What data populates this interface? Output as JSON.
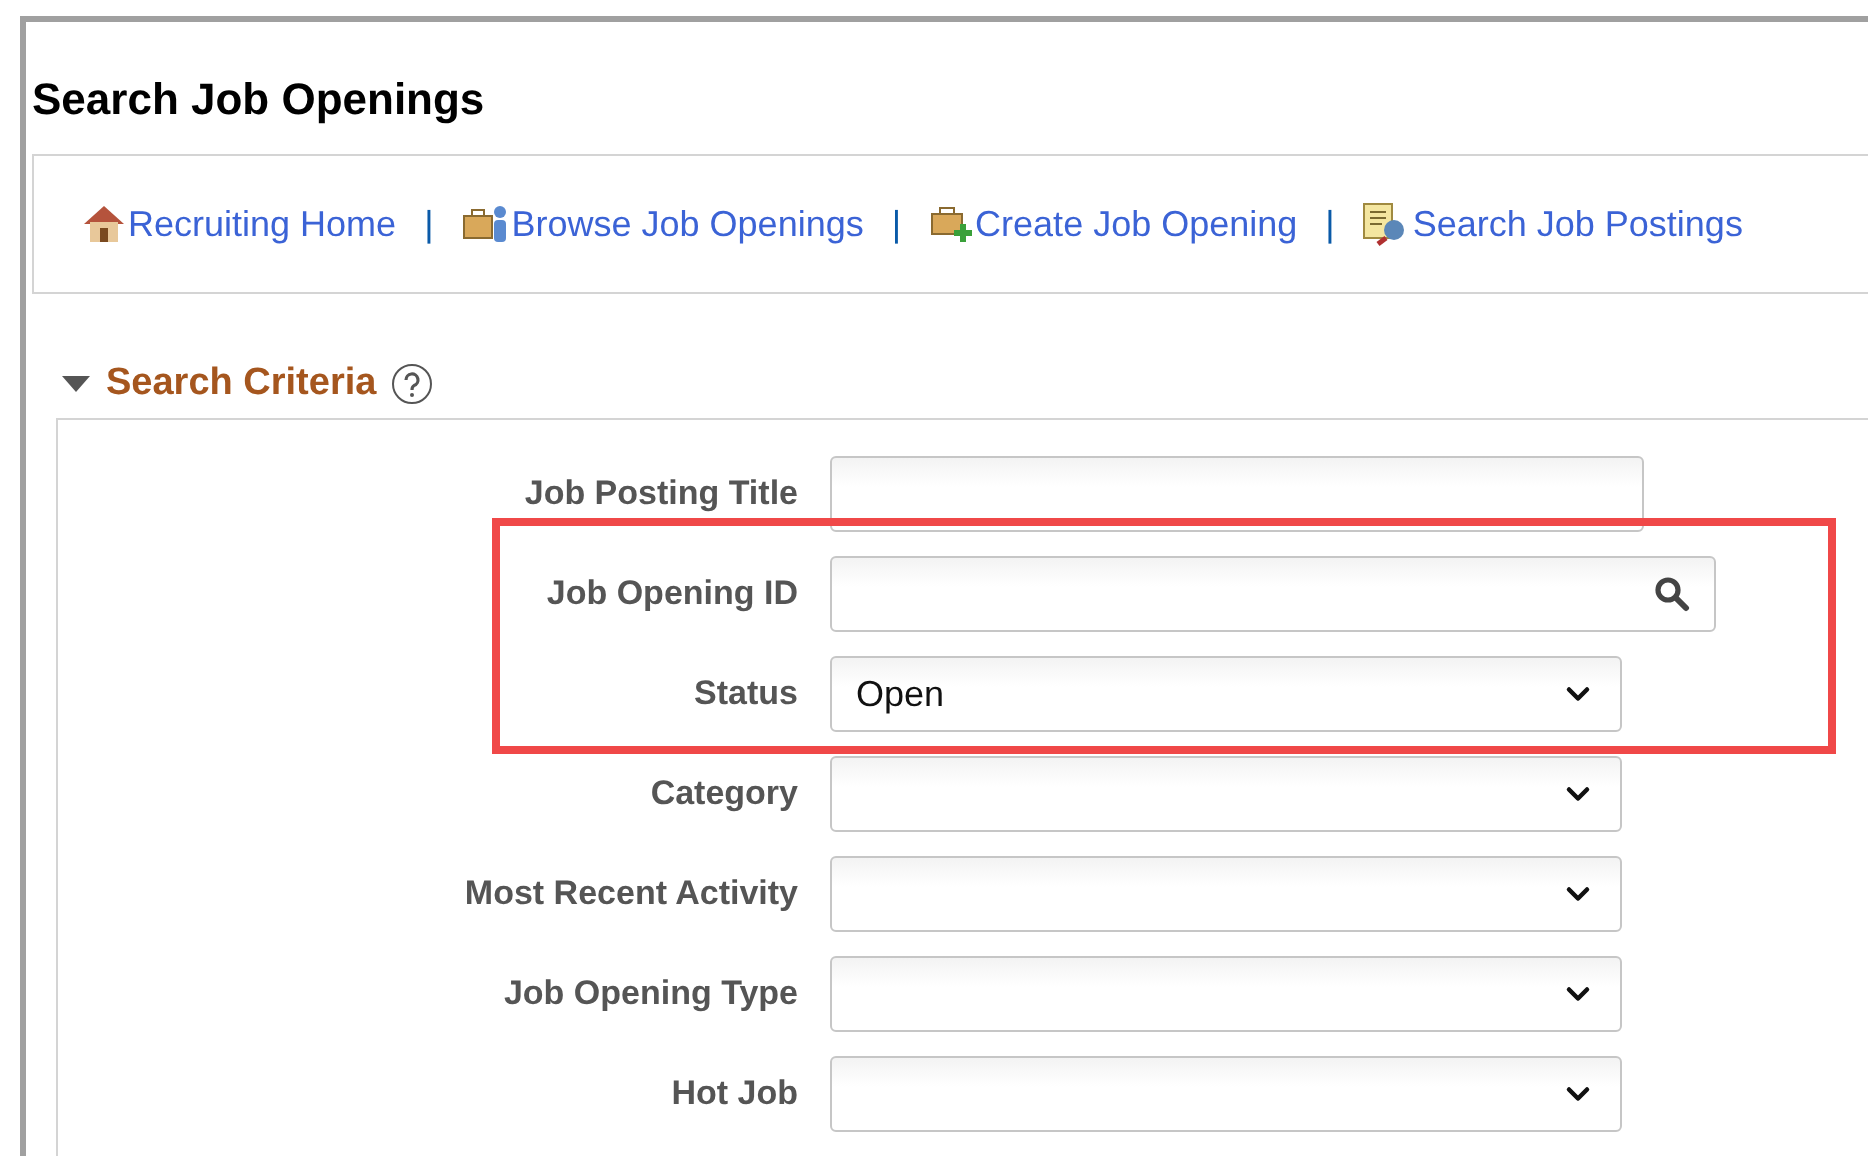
{
  "page_title": "Search Job Openings",
  "nav_links": [
    {
      "label": "Recruiting Home",
      "kind": "home"
    },
    {
      "separator": "|",
      "label": "Browse Job Openings",
      "kind": "browse"
    },
    {
      "separator": "|",
      "label": "Create Job Opening",
      "kind": "create"
    },
    {
      "separator": "|",
      "label": "Search Job Postings",
      "kind": "search"
    }
  ],
  "section": {
    "title": "Search Criteria",
    "expanded": true
  },
  "fields": [
    {
      "label": "Job Posting Title",
      "kind": "text",
      "highlighted": false
    },
    {
      "label": "Job Opening ID",
      "kind": "lookup",
      "highlighted": true
    },
    {
      "label": "Status",
      "kind": "select",
      "value": "Open",
      "highlighted": true
    },
    {
      "label": "Category",
      "kind": "select",
      "highlighted": false
    },
    {
      "label": "Most Recent Activity",
      "kind": "select",
      "highlighted": false
    },
    {
      "label": "Job Opening Type",
      "kind": "select",
      "highlighted": false
    },
    {
      "label": "Hot Job",
      "kind": "select",
      "highlighted": false
    }
  ]
}
